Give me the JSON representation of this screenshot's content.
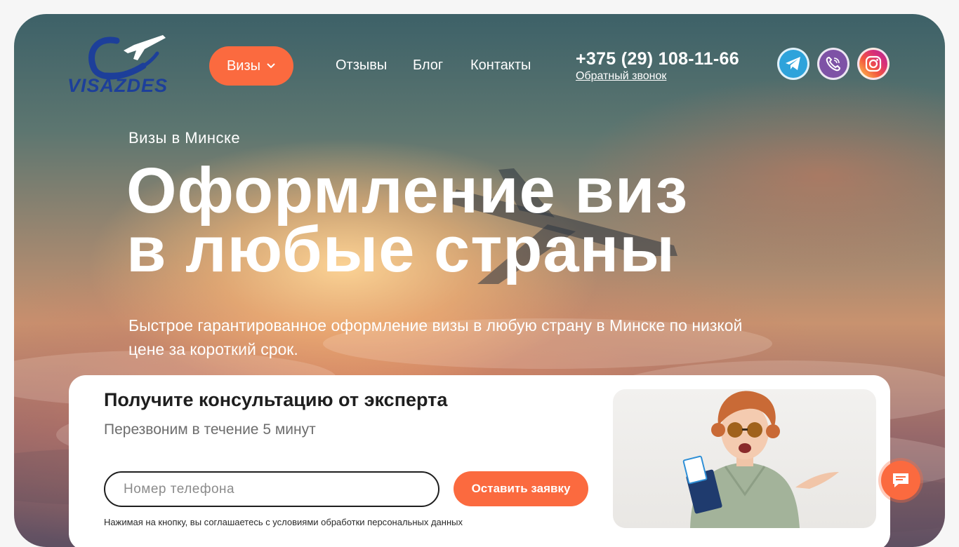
{
  "logo": {
    "text": "VISAZDES"
  },
  "nav": {
    "visas_label": "Визы",
    "links": [
      "Отзывы",
      "Блог",
      "Контакты"
    ]
  },
  "contact": {
    "phone": "+375 (29) 108-11-66",
    "callback_label": "Обратный звонок"
  },
  "social": [
    "telegram-icon",
    "viber-icon",
    "instagram-icon"
  ],
  "hero": {
    "eyebrow": "Визы в Минске",
    "headline_line1": "Оформление виз",
    "headline_line2": "в любые страны",
    "subtitle": "Быстрое гарантированное оформление визы в любую страну в Минске по низкой цене за короткий срок."
  },
  "form": {
    "title": "Получите консультацию от эксперта",
    "subtitle": "Перезвоним в течение 5 минут",
    "phone_placeholder": "Номер телефона",
    "submit_label": "Оставить заявку",
    "consent": "Нажимая на кнопку, вы соглашаетесь с условиями обработки персональных данных"
  },
  "colors": {
    "accent": "#fb6a3f",
    "logo_blue": "#1d3f9a"
  },
  "chat": {
    "icon": "chat-icon"
  }
}
